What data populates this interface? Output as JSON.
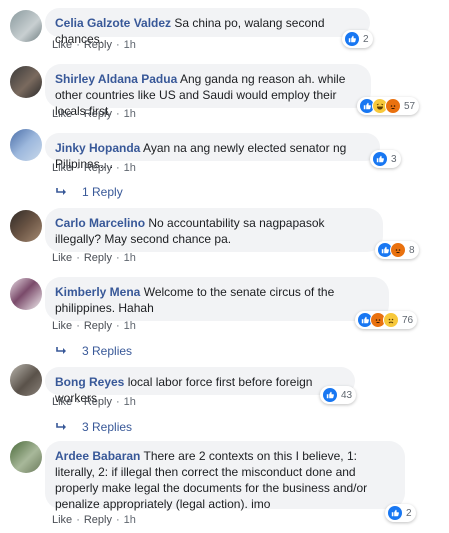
{
  "comments": [
    {
      "author": "Celia Galzote Valdez",
      "text": "Sa china po, walang second chances.",
      "like": "Like",
      "reply": "Reply",
      "time": "1h",
      "reaction_count": "2",
      "reactions": [
        "like"
      ]
    },
    {
      "author": "Shirley Aldana Padua",
      "text": "Ang ganda ng reason ah. while other countries like US and Saudi would employ their locals first.",
      "like": "Like",
      "reply": "Reply",
      "time": "1h",
      "reaction_count": "57",
      "reactions": [
        "like",
        "haha",
        "angry"
      ]
    },
    {
      "author": "Jinky Hopanda",
      "text": "Ayan na ang newly elected senator ng Pilipinas....",
      "like": "Like",
      "reply": "Reply",
      "time": "1h",
      "reaction_count": "3",
      "reactions": [
        "like"
      ],
      "replies_label": "1 Reply"
    },
    {
      "author": "Carlo Marcelino",
      "text": "No accountability sa nagpapasok illegally? May second chance pa.",
      "like": "Like",
      "reply": "Reply",
      "time": "1h",
      "reaction_count": "8",
      "reactions": [
        "like",
        "angry"
      ]
    },
    {
      "author": "Kimberly Mena",
      "text": "Welcome to the senate circus of the philippines. Hahah",
      "like": "Like",
      "reply": "Reply",
      "time": "1h",
      "reaction_count": "76",
      "reactions": [
        "like",
        "angry",
        "sad"
      ],
      "replies_label": "3 Replies"
    },
    {
      "author": "Bong Reyes",
      "text": "local labor force first before foreign workers",
      "like": "Like",
      "reply": "Reply",
      "time": "1h",
      "reaction_count": "43",
      "reactions": [
        "like"
      ],
      "replies_label": "3 Replies"
    },
    {
      "author": "Ardee Babaran",
      "text": "There are 2 contexts on this I believe, 1: literally, 2: if illegal then correct the misconduct done and properly make legal the documents for the business and/or penalize appropriately (legal action). imo",
      "like": "Like",
      "reply": "Reply",
      "time": "1h",
      "reaction_count": "2",
      "reactions": [
        "like"
      ]
    }
  ],
  "colors": {
    "author": "#385898",
    "bubble": "#f2f3f5",
    "meta": "#606770",
    "like_reaction": "#1877f2",
    "haha_reaction": "#f7c83b",
    "angry_reaction": "#e9710f"
  }
}
